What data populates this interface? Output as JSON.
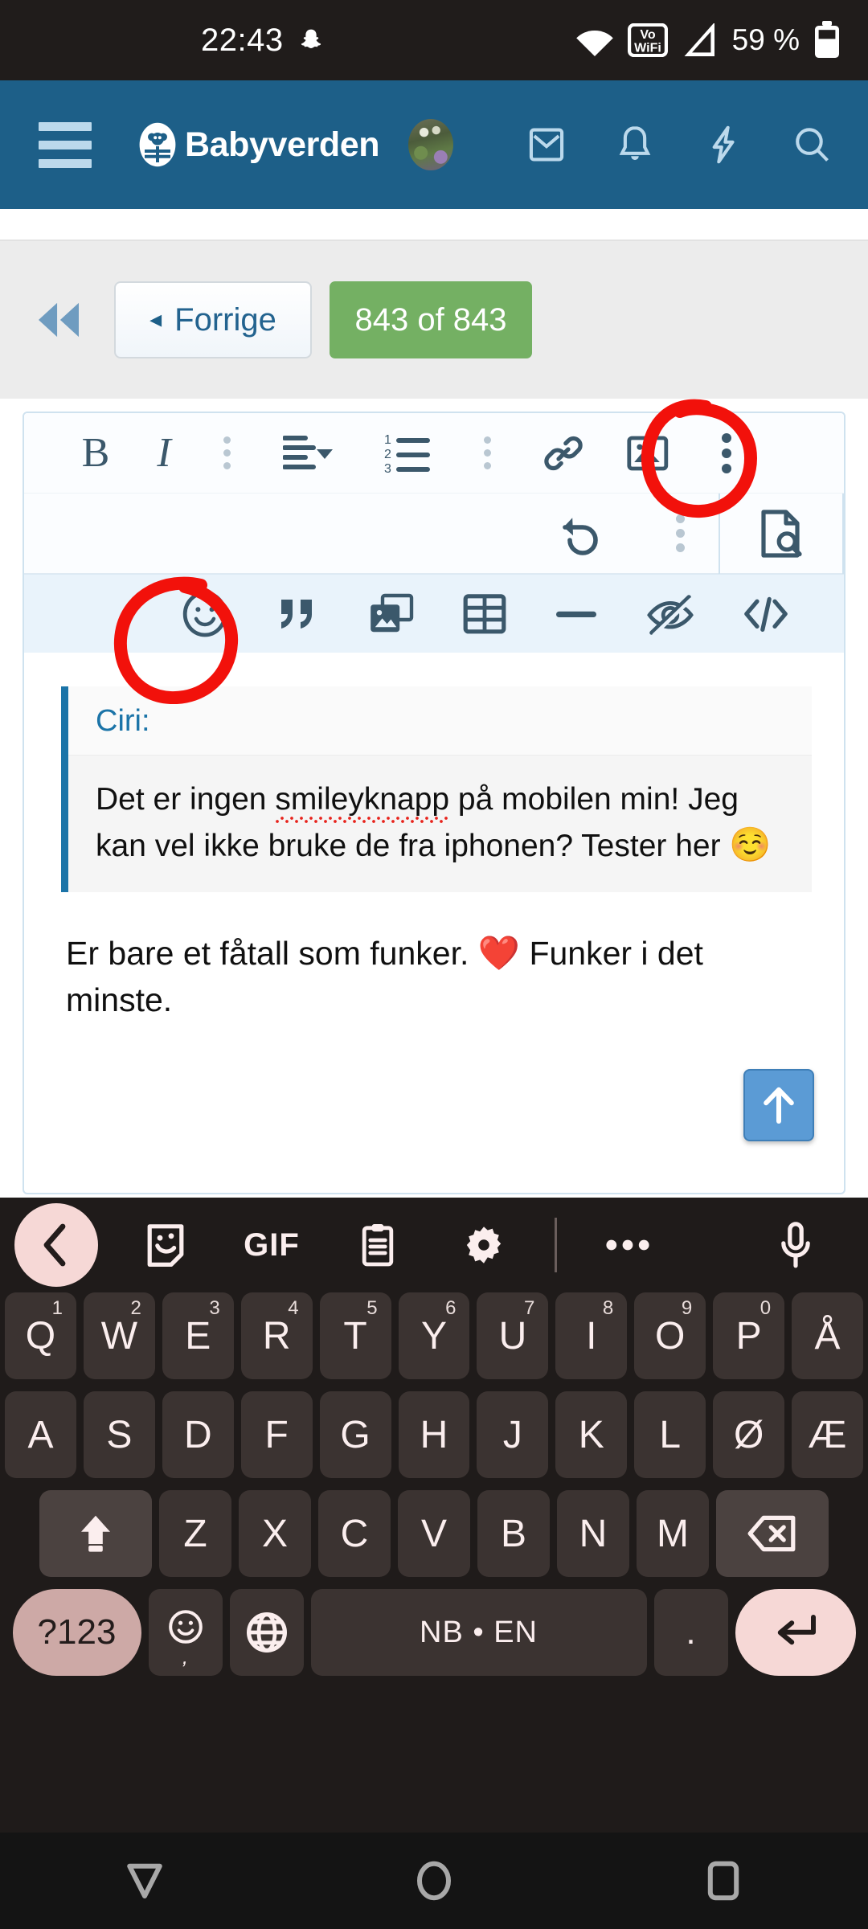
{
  "statusbar": {
    "time": "22:43",
    "snapchat_icon": "snapchat-ghost-icon",
    "wifi_icon": "wifi-icon",
    "vowifi_label_top": "Vo",
    "vowifi_label_bottom": "WiFi",
    "signal_icon": "cellular-signal-icon",
    "battery_percent": "59 %",
    "battery_icon": "battery-icon"
  },
  "header": {
    "menu_icon": "hamburger-menu-icon",
    "brand": "Babyverden",
    "logo_icon": "babyverden-logo-icon",
    "avatar_icon": "user-avatar",
    "icons": [
      "mail-icon",
      "bell-icon",
      "lightning-icon",
      "search-icon"
    ],
    "bg_color": "#1d5f88"
  },
  "pager": {
    "first_icon": "first-page-double-arrow-icon",
    "prev_label": "Forrige",
    "prev_caret": "◂",
    "count_label": "843 of 843",
    "count_bg": "#74b063"
  },
  "editor": {
    "toolbar_row1": [
      {
        "name": "bold-button",
        "label": "B"
      },
      {
        "name": "italic-button",
        "label": "I"
      },
      {
        "name": "toolbar-divider-dots-1",
        "label": ""
      },
      {
        "name": "align-left-dropdown-button",
        "label": ""
      },
      {
        "name": "ordered-list-button",
        "label": ""
      },
      {
        "name": "toolbar-divider-dots-2",
        "label": ""
      },
      {
        "name": "insert-link-button",
        "label": ""
      },
      {
        "name": "insert-image-button",
        "label": ""
      },
      {
        "name": "overflow-menu-button",
        "label": ""
      }
    ],
    "toolbar_row2": [
      {
        "name": "undo-button",
        "label": ""
      },
      {
        "name": "toolbar-divider-dots-3",
        "label": ""
      },
      {
        "name": "preview-document-button",
        "label": ""
      }
    ],
    "toolbar_row3": [
      {
        "name": "emoji-smiley-button",
        "label": ""
      },
      {
        "name": "quote-button",
        "label": ""
      },
      {
        "name": "media-gallery-button",
        "label": ""
      },
      {
        "name": "insert-table-button",
        "label": ""
      },
      {
        "name": "horizontal-rule-button",
        "label": ""
      },
      {
        "name": "spoiler-hide-button",
        "label": ""
      },
      {
        "name": "code-button",
        "label": "</>"
      }
    ],
    "quote": {
      "author": "Ciri:",
      "text_before": "Det er ingen ",
      "misspelled": "smileyknapp",
      "text_after": " på mobilen min! Jeg kan vel ikke bruke de fra iphonen? Tester her ",
      "emoji": "☺️"
    },
    "body": {
      "text_before": "Er bare et fåtall som funker. ",
      "emoji": "❤️",
      "text_after": " Funker i det minste."
    },
    "scroll_top_icon": "scroll-to-top-arrow-icon",
    "border_color": "#cfe2ef",
    "row3_bg": "#e9f3fb"
  },
  "annotations": {
    "color": "#f2110b",
    "circles": [
      "overflow-menu-highlight",
      "emoji-button-highlight"
    ]
  },
  "keyboard": {
    "toolbar": {
      "back_icon": "chevron-left-icon",
      "tools": [
        "sticker-icon",
        "gif-label",
        "clipboard-icon",
        "settings-gear-icon",
        "more-dots-icon",
        "microphone-icon"
      ],
      "gif_label": "GIF"
    },
    "row1": [
      {
        "key": "Q",
        "num": "1"
      },
      {
        "key": "W",
        "num": "2"
      },
      {
        "key": "E",
        "num": "3"
      },
      {
        "key": "R",
        "num": "4"
      },
      {
        "key": "T",
        "num": "5"
      },
      {
        "key": "Y",
        "num": "6"
      },
      {
        "key": "U",
        "num": "7"
      },
      {
        "key": "I",
        "num": "8"
      },
      {
        "key": "O",
        "num": "9"
      },
      {
        "key": "P",
        "num": "0"
      },
      {
        "key": "Å",
        "num": ""
      }
    ],
    "row2": [
      "A",
      "S",
      "D",
      "F",
      "G",
      "H",
      "J",
      "K",
      "L",
      "Ø",
      "Æ"
    ],
    "row3": {
      "shift_icon": "shift-arrow-icon",
      "keys": [
        "Z",
        "X",
        "C",
        "V",
        "B",
        "N",
        "M"
      ],
      "backspace_icon": "backspace-icon"
    },
    "row4": {
      "symbols_label": "?123",
      "emoji_icon": "emoji-smiley-icon",
      "emoji_sub": ",",
      "globe_icon": "language-globe-icon",
      "space_label": "NB • EN",
      "period_label": ".",
      "enter_icon": "enter-return-icon"
    },
    "accent_color": "#f6d8d6",
    "key_color": "#3b3331",
    "bg_color": "#1f1b1a"
  },
  "navbar": {
    "back_icon": "android-back-triangle-icon",
    "home_icon": "android-home-circle-icon",
    "recents_icon": "android-recents-square-icon"
  }
}
